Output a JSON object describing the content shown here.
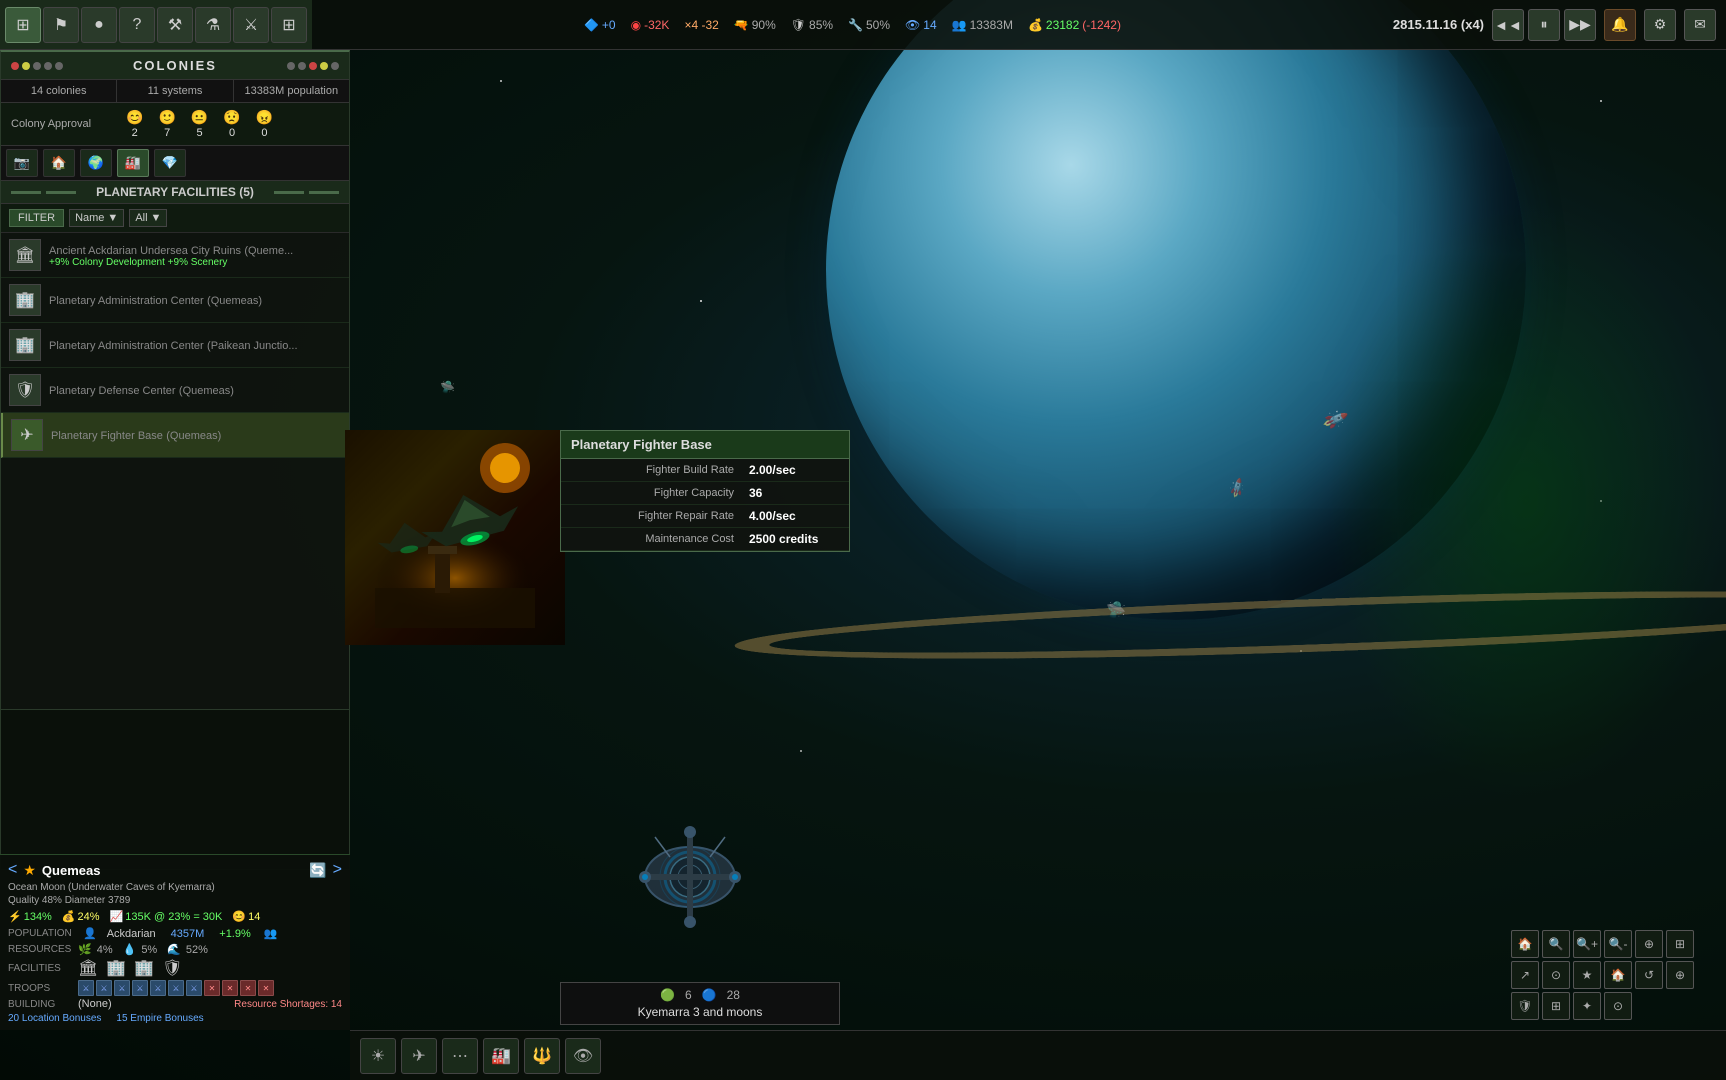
{
  "topNav": {
    "icons": [
      {
        "name": "home-icon",
        "symbol": "⊞",
        "active": true
      },
      {
        "name": "flag-icon",
        "symbol": "⚑",
        "active": false
      },
      {
        "name": "planet-icon",
        "symbol": "●",
        "active": false
      },
      {
        "name": "help-icon",
        "symbol": "?",
        "active": false
      },
      {
        "name": "tools-icon",
        "symbol": "⚒",
        "active": false
      },
      {
        "name": "flask-icon",
        "symbol": "⚗",
        "active": false
      },
      {
        "name": "tactics-icon",
        "symbol": "⚔",
        "active": false
      },
      {
        "name": "grid-icon",
        "symbol": "⊞",
        "active": false
      }
    ],
    "stats": [
      {
        "label": "+0",
        "color": "blue",
        "icon": "🔷"
      },
      {
        "label": "-32K",
        "color": "red",
        "icon": "🔴"
      },
      {
        "label": "×4 -32",
        "color": "orange",
        "icon": "✕"
      },
      {
        "label": "90%",
        "color": "gray",
        "icon": "🔫"
      },
      {
        "label": "85%",
        "color": "gray",
        "icon": "🛡"
      },
      {
        "label": "50%",
        "color": "gray",
        "icon": "🔧"
      },
      {
        "label": "14",
        "color": "blue",
        "icon": "👁"
      },
      {
        "label": "13383M",
        "color": "gray",
        "icon": "👥"
      },
      {
        "label": "23182",
        "color": "green",
        "icon": "💰"
      },
      {
        "label": "(-1242)",
        "color": "red",
        "icon": ""
      }
    ],
    "date": "2815.11.16 (x4)",
    "cornerIcons": [
      "◄◄",
      "⏸",
      "▶▶"
    ]
  },
  "coloniesPanel": {
    "title": "COLONIES",
    "tabs": [
      {
        "label": "14 colonies",
        "active": false
      },
      {
        "label": "11 systems",
        "active": false
      },
      {
        "label": "13383M population",
        "active": false
      }
    ],
    "approvalLabel": "Colony Approval",
    "approvalGroups": [
      {
        "emoji": "😊",
        "count": "2"
      },
      {
        "emoji": "🙂",
        "count": "7"
      },
      {
        "emoji": "😐",
        "count": "5"
      },
      {
        "emoji": "😟",
        "count": "0"
      },
      {
        "emoji": "😠",
        "count": "0"
      }
    ],
    "tabIcons": [
      "📷",
      "🏠",
      "🌍",
      "🏭",
      "💎"
    ],
    "facilitiesTitle": "PLANETARY FACILITIES (5)",
    "filter": {
      "label": "FILTER",
      "sortLabel": "Name",
      "filterLabel": "All"
    },
    "facilities": [
      {
        "name": "Ancient Ackdarian Undersea City Ruins",
        "location": "(Queme...",
        "bonus": "+9% Colony Development  +9% Scenery",
        "icon": "🏛",
        "selected": false
      },
      {
        "name": "Planetary Administration Center",
        "location": "(Quemeas)",
        "bonus": "",
        "icon": "🏢",
        "selected": false
      },
      {
        "name": "Planetary Administration Center",
        "location": "(Paikean Junctio...",
        "bonus": "",
        "icon": "🏢",
        "selected": false
      },
      {
        "name": "Planetary Defense Center",
        "location": "(Quemeas)",
        "bonus": "",
        "icon": "🛡",
        "selected": false
      },
      {
        "name": "Planetary Fighter Base",
        "location": "(Quemeas)",
        "bonus": "",
        "icon": "✈",
        "selected": true
      }
    ]
  },
  "fighterBaseTooltip": {
    "title": "Planetary Fighter Base",
    "rows": [
      {
        "label": "Fighter Build Rate",
        "value": "2.00/sec"
      },
      {
        "label": "Fighter Capacity",
        "value": "36"
      },
      {
        "label": "Fighter Repair Rate",
        "value": "4.00/sec"
      },
      {
        "label": "Maintenance Cost",
        "value": "2500 credits"
      }
    ]
  },
  "planetInfo": {
    "star": "★",
    "name": "Quemeas",
    "subtitle": "Ocean Moon (Underwater Caves of Kyemarra)",
    "quality": "Quality 48%  Diameter 3789",
    "stats": [
      {
        "icon": "⚡",
        "value": "134%",
        "color": "green"
      },
      {
        "icon": "💰",
        "value": "24%",
        "color": "yellow"
      },
      {
        "icon": "👥",
        "value": "135K @ 23% = 30K",
        "color": "green"
      },
      {
        "icon": "😊",
        "value": "14",
        "color": "yellow"
      }
    ],
    "populationLabel": "POPULATION",
    "race": "Ackdarian",
    "popCount": "4357M",
    "popGrowth": "+1.9%",
    "resourcesLabel": "RESOURCES",
    "resources": "4%  🌊5%  💧52%",
    "facilitiesLabel": "FACILITIES",
    "troopsLabel": "TROOPS",
    "buildingLabel": "BUILDING",
    "buildingValue": "(None)",
    "shortages": "Resource Shortages: 14",
    "bonuses": [
      "20 Location Bonuses",
      "15 Empire Bonuses"
    ]
  },
  "kyemarraPanel": {
    "count1": "6",
    "count2": "28",
    "name": "Kyemarra 3 and moons"
  },
  "bottomNav": {
    "icons": [
      "☀",
      "✈",
      "⋯",
      "🏭",
      "🔱",
      "👁"
    ]
  }
}
